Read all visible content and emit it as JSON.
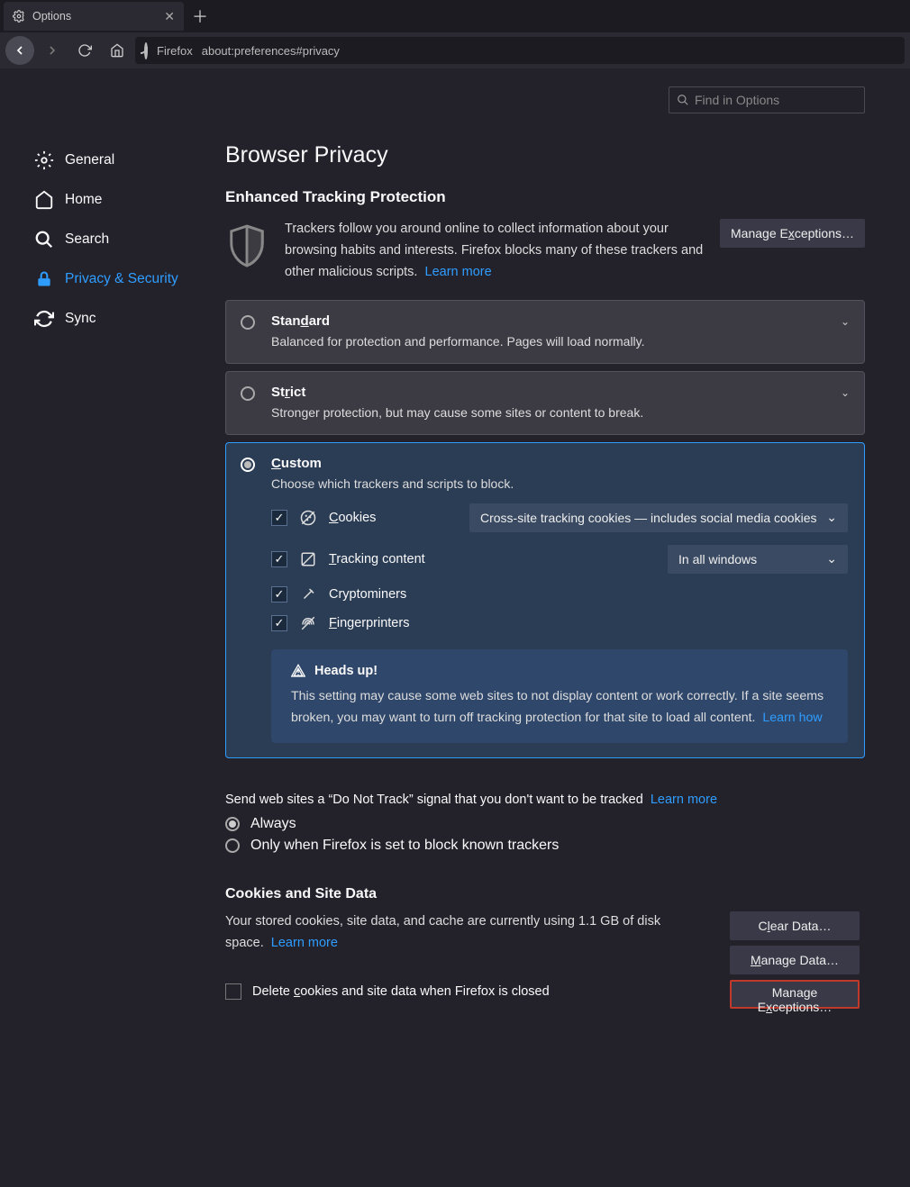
{
  "tab": {
    "title": "Options"
  },
  "url": {
    "prefix": "Firefox",
    "path": "about:preferences#privacy"
  },
  "search": {
    "placeholder": "Find in Options"
  },
  "sidebar": {
    "general": "General",
    "home": "Home",
    "search": "Search",
    "privacy": "Privacy & Security",
    "sync": "Sync"
  },
  "page": {
    "h1": "Browser Privacy",
    "etp_h2": "Enhanced Tracking Protection",
    "etp_desc": "Trackers follow you around online to collect information about your browsing habits and interests. Firefox blocks many of these trackers and other malicious scripts.",
    "learn_more": "Learn more",
    "manage_exceptions": "Manage Exceptions…",
    "standard": {
      "title_pre": "Stan",
      "title_u": "d",
      "title_post": "ard",
      "desc": "Balanced for protection and performance. Pages will load normally."
    },
    "strict": {
      "title_pre": "St",
      "title_u": "r",
      "title_post": "ict",
      "desc": "Stronger protection, but may cause some sites or content to break."
    },
    "custom": {
      "title_u": "C",
      "title_post": "ustom",
      "desc": "Choose which trackers and scripts to block."
    },
    "opts": {
      "cookies_u": "C",
      "cookies_post": "ookies",
      "cookies_select": "Cross-site tracking cookies — includes social media cookies",
      "tracking_u": "T",
      "tracking_post": "racking content",
      "tracking_select": "In all windows",
      "crypto": "Cryptominers",
      "finger_u": "F",
      "finger_post": "ingerprinters"
    },
    "warn": {
      "title": "Heads up!",
      "body": "This setting may cause some web sites to not display content or work correctly. If a site seems broken, you may want to turn off tracking protection for that site to load all content.",
      "link": "Learn how"
    },
    "dnt": {
      "text": "Send web sites a “Do Not Track” signal that you don't want to be tracked",
      "learn": "Learn more",
      "always": "Always",
      "only": "Only when Firefox is set to block known trackers"
    },
    "cookies": {
      "h3": "Cookies and Site Data",
      "usage": "Your stored cookies, site data, and cache are currently using 1.1 GB of disk space.",
      "learn": "Learn more",
      "delete_pre": "Delete ",
      "delete_u": "c",
      "delete_post": "ookies and site data when Firefox is closed",
      "clear": "Clear Data…",
      "manage": "Manage Data…",
      "exceptions": "Manage Exceptions…"
    }
  }
}
